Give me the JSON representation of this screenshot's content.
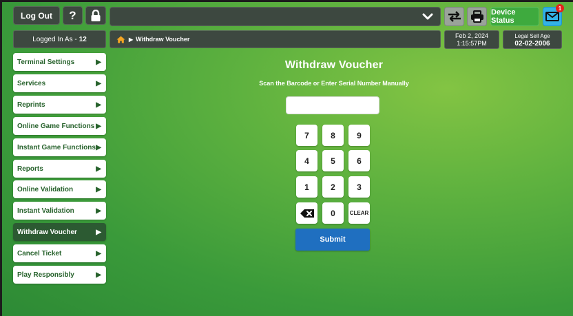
{
  "header": {
    "logout_label": "Log Out",
    "help_label": "?",
    "device_status_label": "Device Status",
    "mail_badge_count": "1"
  },
  "session": {
    "logged_in_label": "Logged In As -",
    "logged_in_value": "12"
  },
  "breadcrumb": {
    "current": "Withdraw Voucher"
  },
  "status": {
    "date": "Feb 2, 2024",
    "time": "1:15:57PM",
    "legal_age_label": "Legal Sell Age",
    "legal_age_value": "02-02-2006"
  },
  "sidebar": {
    "items": [
      {
        "label": "Terminal Settings"
      },
      {
        "label": "Services"
      },
      {
        "label": "Reprints"
      },
      {
        "label": "Online Game Functions"
      },
      {
        "label": "Instant Game Functions"
      },
      {
        "label": "Reports"
      },
      {
        "label": "Online Validation"
      },
      {
        "label": "Instant Validation"
      },
      {
        "label": "Withdraw Voucher"
      },
      {
        "label": "Cancel Ticket"
      },
      {
        "label": "Play Responsibly"
      }
    ],
    "active_index": 8
  },
  "main": {
    "title": "Withdraw Voucher",
    "subtitle": "Scan the Barcode or Enter Serial Number Manually",
    "serial_value": "",
    "serial_placeholder": "",
    "keypad": [
      "7",
      "8",
      "9",
      "4",
      "5",
      "6",
      "1",
      "2",
      "3",
      "backspace-icon",
      "0",
      "CLEAR"
    ],
    "submit_label": "Submit"
  },
  "icons": {
    "chevron": "chevron-down-icon",
    "transfer": "transfer-arrows-icon",
    "print": "printer-icon",
    "mail": "mail-icon",
    "lock": "lock-icon",
    "home": "home-icon"
  },
  "colors": {
    "panel": "#3d4840",
    "active_item": "#2c5a32",
    "item_text": "#27622c",
    "submit": "#1f6fc0",
    "device_status": "#3eaa3e",
    "mail": "#33b2e6",
    "home": "#f6a623"
  }
}
